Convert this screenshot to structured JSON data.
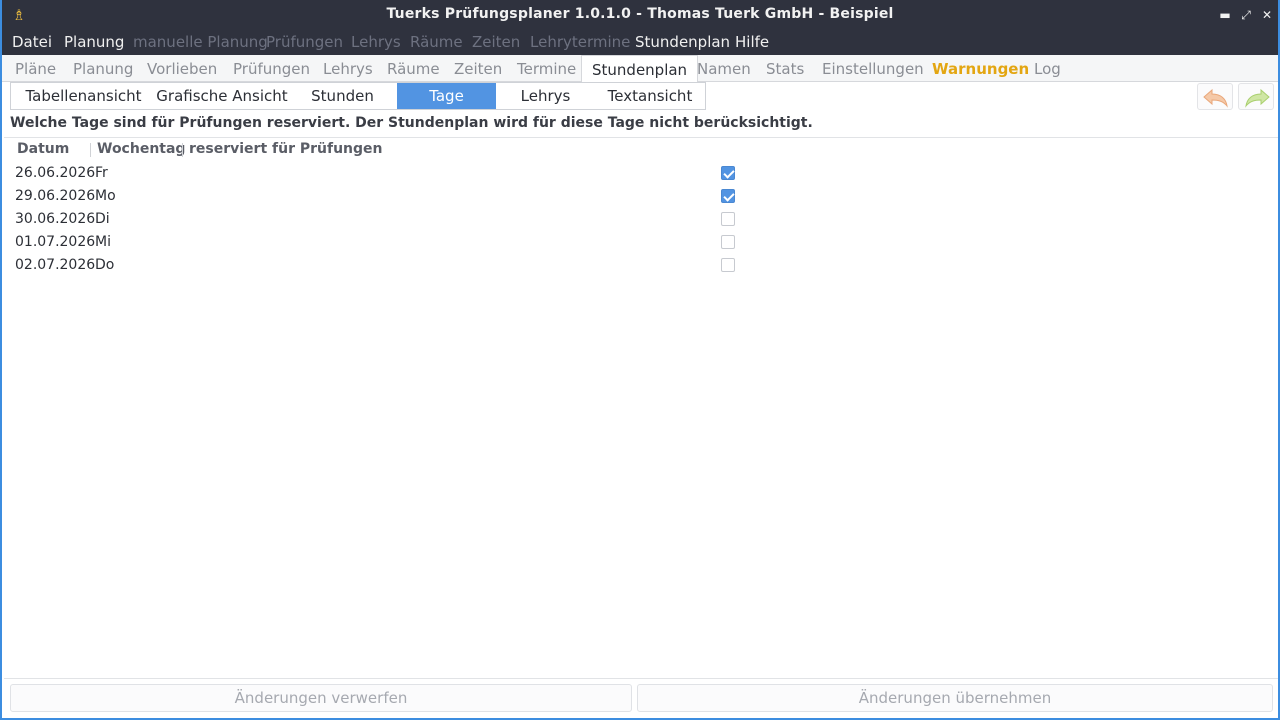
{
  "window": {
    "title": "Tuerks Prüfungsplaner 1.0.1.0 - Thomas Tuerk GmbH - Beispiel",
    "app_icon": "♗",
    "controls": {
      "minimize": "▬",
      "maximize": "⤢",
      "close": "✕"
    }
  },
  "menubar": {
    "items": [
      {
        "label": "Datei",
        "enabled": true
      },
      {
        "label": "Planung",
        "enabled": true
      },
      {
        "label": "manuelle Planung",
        "enabled": false
      },
      {
        "label": "Prüfungen",
        "enabled": false
      },
      {
        "label": "Lehrys",
        "enabled": false
      },
      {
        "label": "Räume",
        "enabled": false
      },
      {
        "label": "Zeiten",
        "enabled": false
      },
      {
        "label": "Lehrytermine",
        "enabled": false
      },
      {
        "label": "Stundenplan",
        "enabled": true
      },
      {
        "label": "Hilfe",
        "enabled": true
      }
    ]
  },
  "tabs": {
    "items": [
      "Pläne",
      "Planung",
      "Vorlieben",
      "Prüfungen",
      "Lehrys",
      "Räume",
      "Zeiten",
      "Termine",
      "Stundenplan",
      "Namen",
      "Stats",
      "Einstellungen",
      "Warnungen",
      "Log"
    ],
    "active": "Stundenplan",
    "warning_tab": "Warnungen",
    "warning_color": "#e3a612"
  },
  "subtabs": {
    "items": [
      "Tabellenansicht",
      "Grafische Ansicht",
      "Stunden",
      "Tage",
      "Lehrys",
      "Textansicht"
    ],
    "active": "Tage",
    "accent": "#5294e2"
  },
  "toolbar": {
    "undo_icon": "undo-arrow-icon",
    "redo_icon": "redo-arrow-icon"
  },
  "hint": "Welche Tage sind für Prüfungen reserviert. Der Stundenplan wird für diese Tage nicht berücksichtigt.",
  "table": {
    "columns": [
      "Datum",
      "Wochentag",
      "reserviert für Prüfungen"
    ],
    "rows": [
      {
        "date": "26.06.2026",
        "weekday": "Fr",
        "reserved": true
      },
      {
        "date": "29.06.2026",
        "weekday": "Mo",
        "reserved": true
      },
      {
        "date": "30.06.2026",
        "weekday": "Di",
        "reserved": false
      },
      {
        "date": "01.07.2026",
        "weekday": "Mi",
        "reserved": false
      },
      {
        "date": "02.07.2026",
        "weekday": "Do",
        "reserved": false
      }
    ]
  },
  "buttons": {
    "discard": "Änderungen verwerfen",
    "apply": "Änderungen übernehmen"
  }
}
